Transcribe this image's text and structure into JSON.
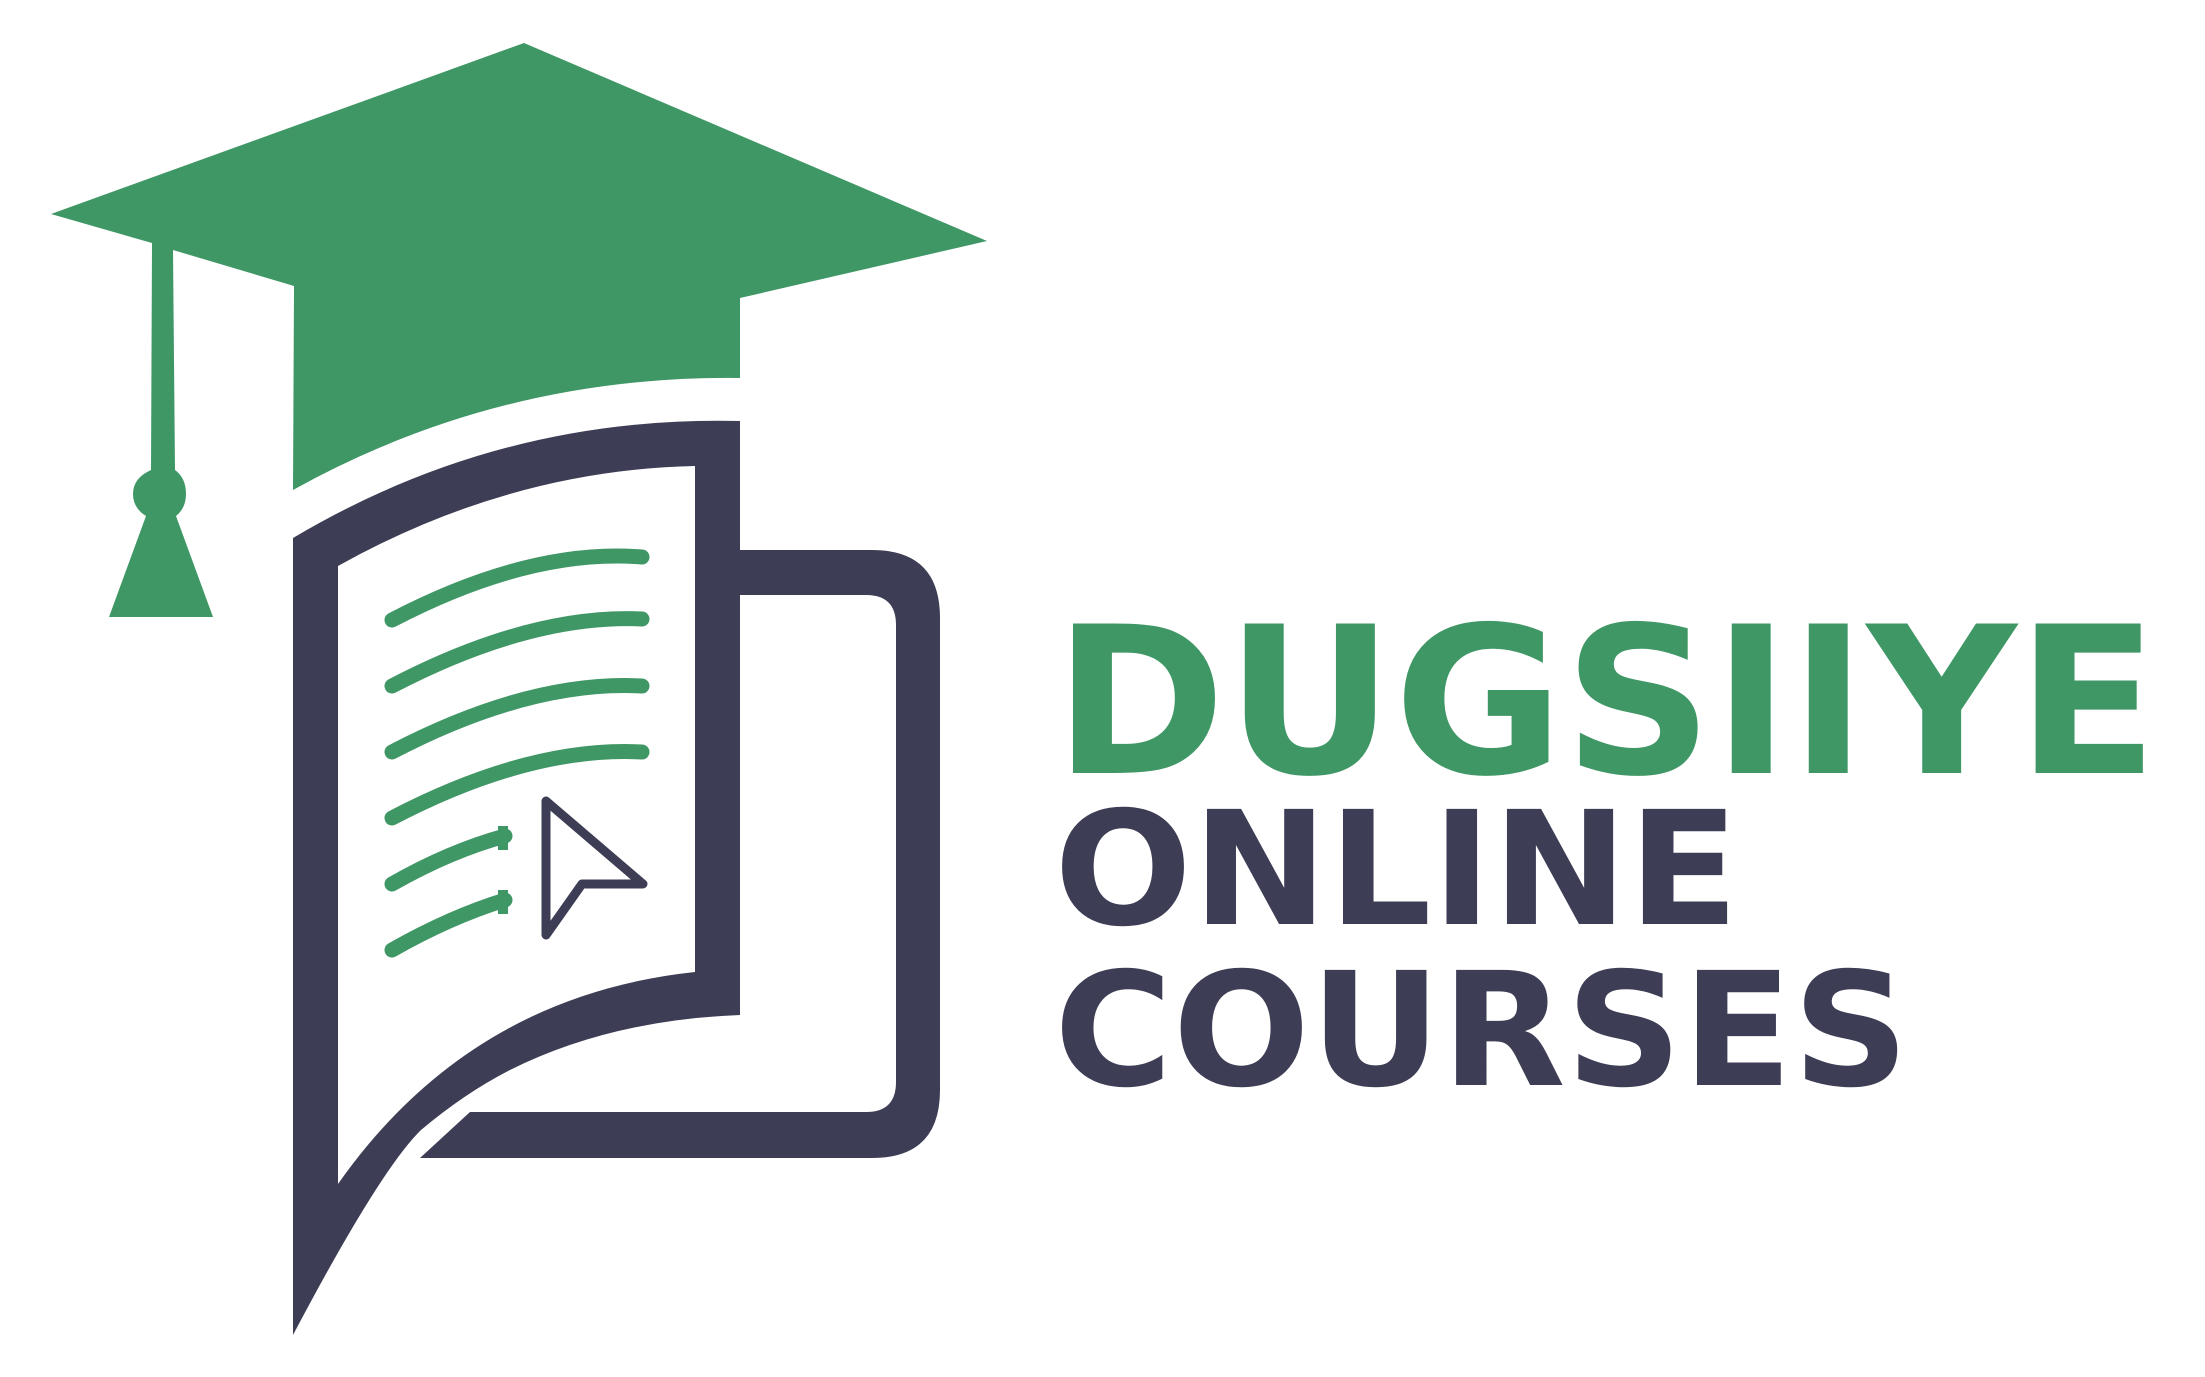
{
  "brand": {
    "name_line1": "DUGSIIYE",
    "name_line2": "ONLINE",
    "name_line3": "COURSES"
  },
  "colors": {
    "green": "#409766",
    "navy": "#3d3d55",
    "background": "#ffffff"
  },
  "icons": {
    "cap": "graduation-cap-icon",
    "book": "book-chat-bubble-icon",
    "cursor": "mouse-cursor-icon"
  }
}
